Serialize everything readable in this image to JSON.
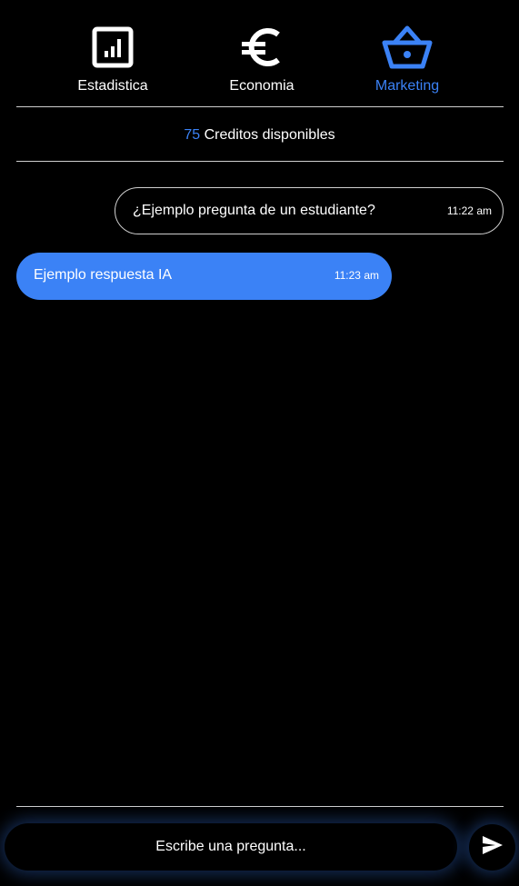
{
  "tabs": [
    {
      "label": "Estadistica",
      "icon": "chart-icon",
      "active": false
    },
    {
      "label": "Economia",
      "icon": "euro-icon",
      "active": false
    },
    {
      "label": "Marketing",
      "icon": "basket-icon",
      "active": true
    }
  ],
  "credits": {
    "count": "75",
    "label": "Creditos disponibles"
  },
  "messages": [
    {
      "role": "user",
      "text": "¿Ejemplo pregunta de un estudiante?",
      "time": "11:22 am"
    },
    {
      "role": "ai",
      "text": "Ejemplo respuesta IA",
      "time": "11:23 am"
    }
  ],
  "composer": {
    "placeholder": "Escribe una pregunta...",
    "send_icon": "send-icon"
  },
  "colors": {
    "accent": "#3b82f6",
    "background": "#000000",
    "text": "#ffffff",
    "divider": "#cfcfcf"
  }
}
